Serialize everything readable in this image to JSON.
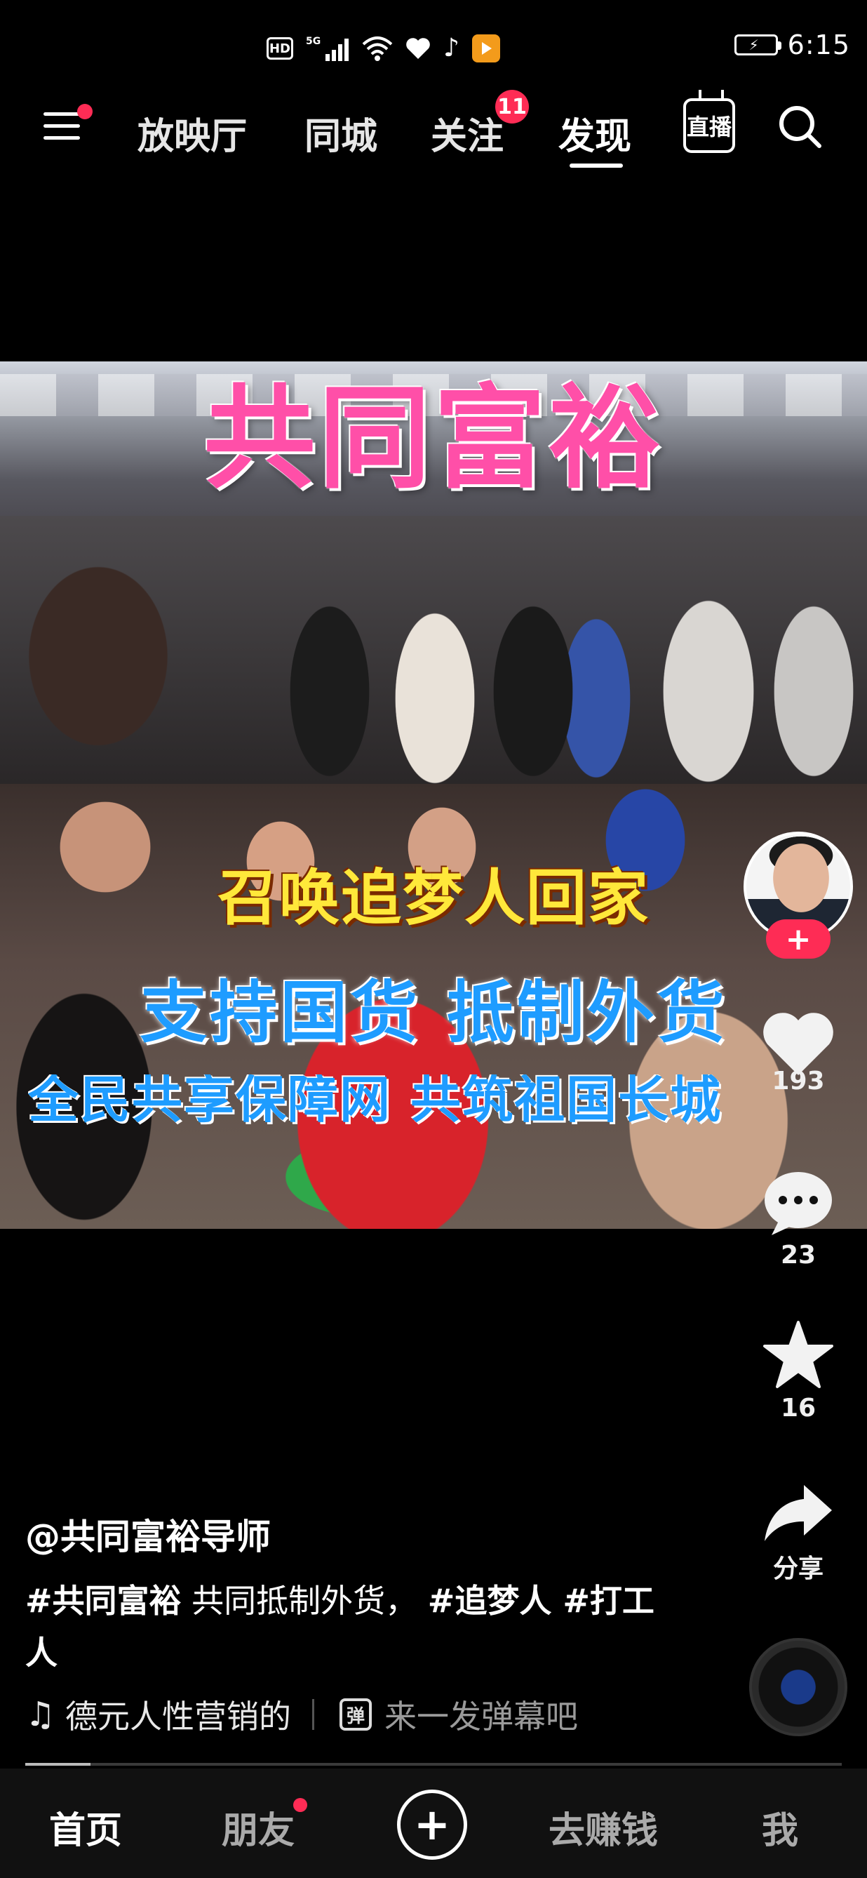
{
  "status_bar": {
    "hd": "HD",
    "network": "5G",
    "time": "6:15"
  },
  "top_nav": {
    "tabs": [
      "放映厅",
      "同城",
      "关注",
      "发现"
    ],
    "active_tab": "发现",
    "follow_badge": "11",
    "live_label": "直播"
  },
  "video": {
    "title": "共同富裕",
    "caption_1": "召唤追梦人回家",
    "caption_2": "支持国货  抵制外货",
    "caption_3": "全民共享保障网  共筑祖国长城"
  },
  "actions": {
    "like_count": "193",
    "comment_count": "23",
    "favorite_count": "16",
    "share_label": "分享",
    "follow_plus": "+"
  },
  "post": {
    "author": "@共同富裕导师",
    "tag_1": "#共同富裕",
    "text_1": " 共同抵制外货， ",
    "tag_2": "#追梦人",
    "tag_3": " #打工人",
    "music": "德元人性营销的",
    "danmu_icon": "弹",
    "danmu_placeholder": "来一发弹幕吧",
    "progress": 0.08
  },
  "bottom_tabs": {
    "home": "首页",
    "friends": "朋友",
    "plus": "+",
    "earn": "去赚钱",
    "me": "我"
  },
  "colors": {
    "accent": "#fe2c55",
    "background": "#000000"
  }
}
